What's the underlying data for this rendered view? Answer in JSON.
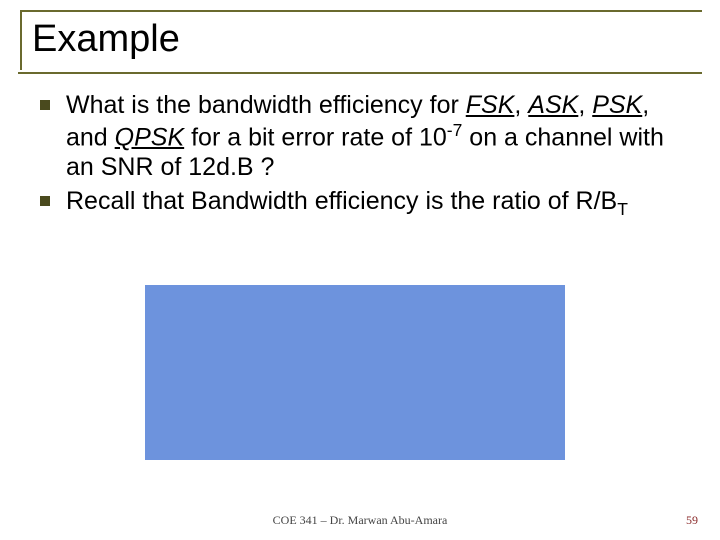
{
  "title": "Example",
  "bullets": [
    {
      "pre": "What is the bandwidth efficiency for ",
      "m1": "FSK",
      "c1": ", ",
      "m2": "ASK",
      "c2": ", ",
      "m3": "PSK",
      "c3": ", and ",
      "m4": "QPSK",
      "post1": " for a bit error rate of 10",
      "exp": "-7",
      "post2": " on a channel with an SNR of 12d.B ?"
    },
    {
      "pre": "Recall that Bandwidth efficiency is the ratio of R/B",
      "sub": "T"
    }
  ],
  "footer": "COE 341 – Dr. Marwan Abu-Amara",
  "page": "59"
}
